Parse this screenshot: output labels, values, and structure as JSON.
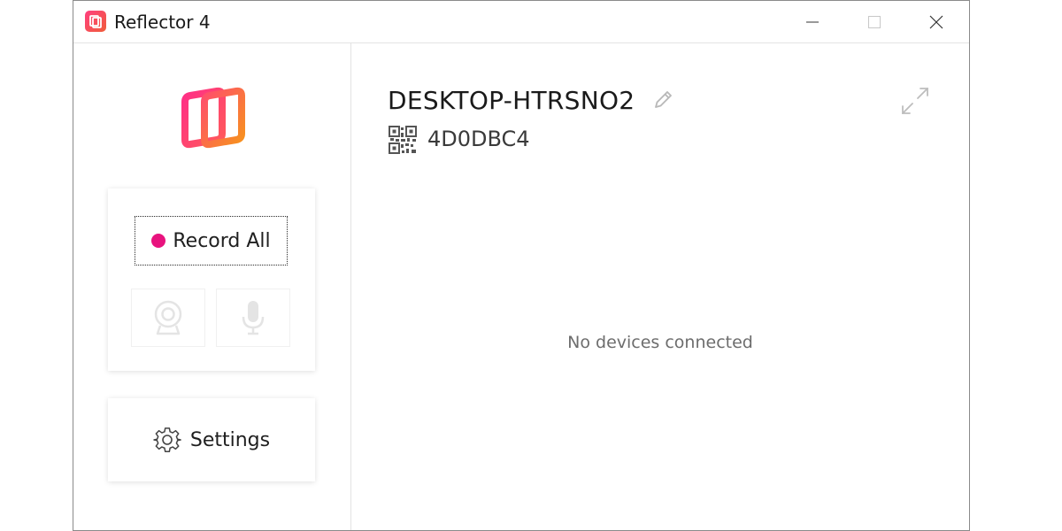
{
  "window": {
    "title": "Reflector 4",
    "app_icon": "reflector-app-icon"
  },
  "title_controls": {
    "minimize_icon": "minimize-icon",
    "maximize_icon": "maximize-icon",
    "close_icon": "close-icon"
  },
  "sidebar": {
    "logo_icon": "reflector-logo-icon",
    "record_all_label": "Record All",
    "record_dot_color": "#e8137e",
    "camera_icon": "webcam-icon",
    "microphone_icon": "microphone-icon",
    "settings_label": "Settings",
    "settings_icon": "gear-icon"
  },
  "main": {
    "device_name": "DESKTOP-HTRSNO2",
    "edit_icon": "pencil-icon",
    "qr_icon": "qr-code-icon",
    "device_code": "4D0DBC4",
    "fullscreen_icon": "expand-icon",
    "empty_message": "No devices connected"
  },
  "colors": {
    "accent_pink": "#ff3f7f",
    "accent_orange": "#f7921e",
    "record_dot": "#e8137e"
  }
}
